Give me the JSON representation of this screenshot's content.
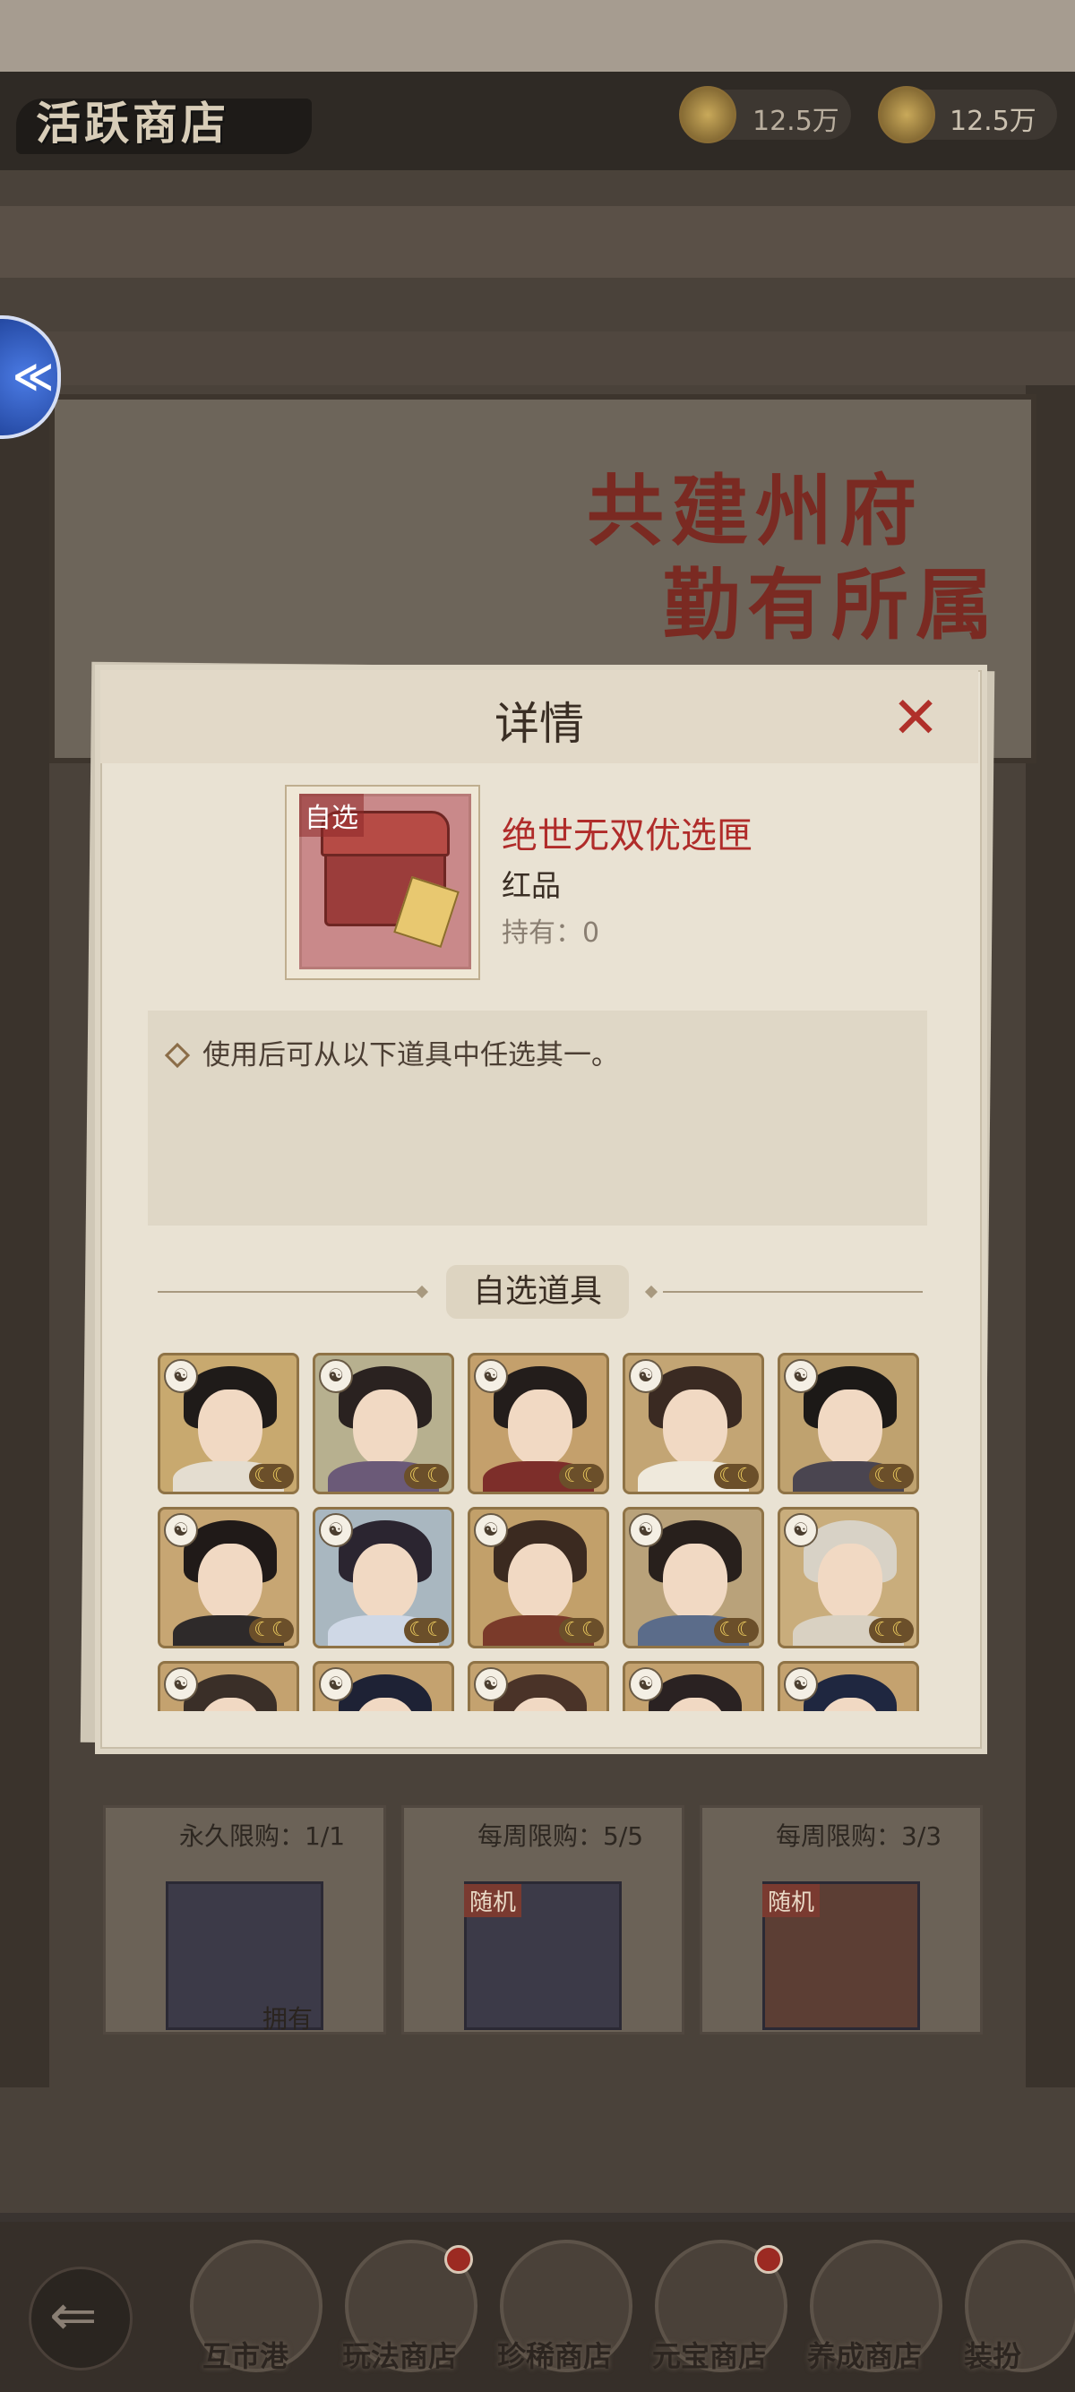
{
  "header": {
    "title": "活跃商店",
    "currencies": [
      {
        "icon": "copper-coin-icon",
        "value": "12.5万"
      },
      {
        "icon": "gold-coin-icon",
        "value": "12.5万"
      }
    ]
  },
  "banner": {
    "line1": "共建州府",
    "line2": "勤有所属"
  },
  "shop_cards": [
    {
      "limit": "永久限购：1/1",
      "tag": "",
      "status": "拥有"
    },
    {
      "limit": "每周限购：5/5",
      "tag": "随机",
      "status": ""
    },
    {
      "limit": "每周限购：3/3",
      "tag": "随机",
      "status": ""
    }
  ],
  "bottom_nav": [
    {
      "label": "互市港",
      "badge": false
    },
    {
      "label": "玩法商店",
      "badge": true
    },
    {
      "label": "珍稀商店",
      "badge": false
    },
    {
      "label": "元宝商店",
      "badge": true
    },
    {
      "label": "养成商店",
      "badge": false
    },
    {
      "label": "装扮",
      "badge": false
    }
  ],
  "modal": {
    "title": "详情",
    "close_symbol": "✕",
    "item": {
      "tag": "自选",
      "name": "绝世无双优选匣",
      "grade": "红品",
      "owned": "持有：0"
    },
    "description": "使用后可从以下道具中任选其一。",
    "section_title": "自选道具",
    "heroes": [
      {
        "faction_icon": "scholar-icon",
        "badge": "☾☾"
      },
      {
        "faction_icon": "scholar-icon",
        "badge": "☾☾"
      },
      {
        "faction_icon": "scholar-icon",
        "badge": "☾☾"
      },
      {
        "faction_icon": "scholar-icon",
        "badge": "☾☾"
      },
      {
        "faction_icon": "scholar-icon",
        "badge": "☾☾"
      },
      {
        "faction_icon": "scholar-icon",
        "badge": "☾☾"
      },
      {
        "faction_icon": "scholar-icon",
        "badge": "☾☾"
      },
      {
        "faction_icon": "scholar-icon",
        "badge": "☾☾"
      },
      {
        "faction_icon": "scholar-icon",
        "badge": "☾☾"
      },
      {
        "faction_icon": "scholar-icon",
        "badge": "☾☾"
      },
      {
        "faction_icon": "scholar-icon",
        "badge": ""
      },
      {
        "faction_icon": "scholar-icon",
        "badge": ""
      },
      {
        "faction_icon": "scholar-icon",
        "badge": ""
      },
      {
        "faction_icon": "scholar-icon",
        "badge": ""
      },
      {
        "faction_icon": "scholar-icon",
        "badge": ""
      }
    ]
  },
  "colors": {
    "accent_red": "#b02c2a",
    "parchment": "#e9e2d3",
    "card_gold": "#b99767"
  }
}
